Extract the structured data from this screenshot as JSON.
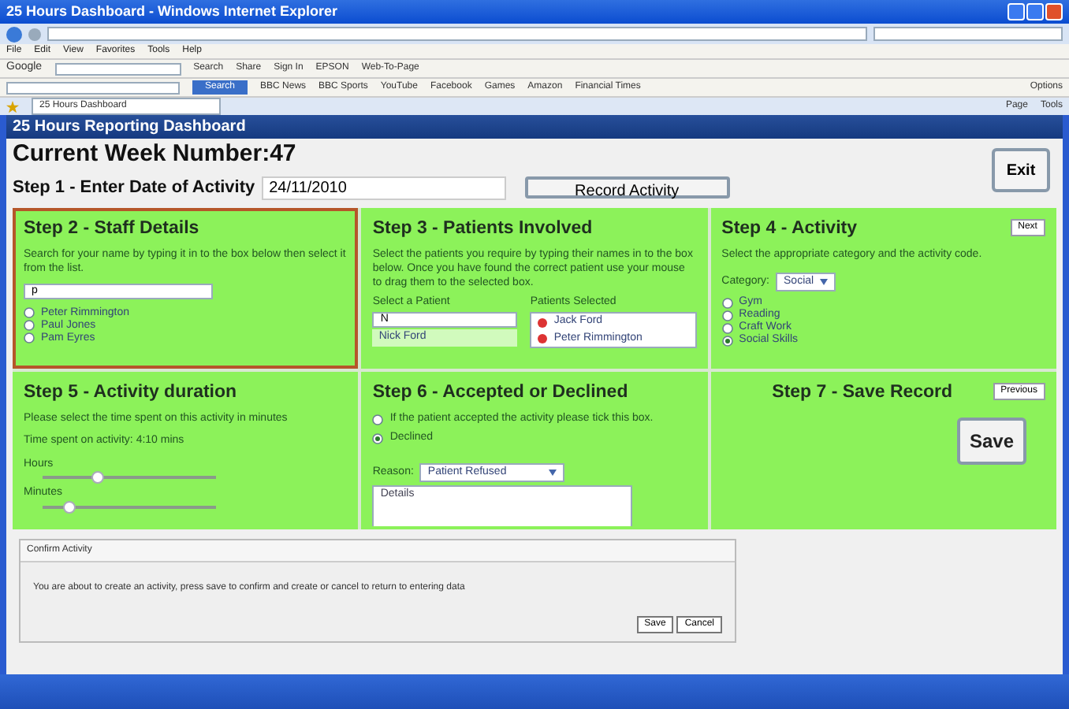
{
  "window": {
    "title": "25 Hours Dashboard - Windows Internet Explorer"
  },
  "browser": {
    "menu": [
      "File",
      "Edit",
      "View",
      "Favorites",
      "Tools",
      "Help"
    ],
    "google_toolbar": {
      "label": "Google",
      "items": [
        "Search",
        "Share",
        "Sign In",
        "EPSON",
        "Web-To-Page"
      ]
    },
    "links_toolbar": {
      "button": "Search",
      "items": [
        "BBC News",
        "BBC Sports",
        "YouTube",
        "Facebook",
        "Games",
        "Amazon",
        "Financial Times"
      ],
      "options": "Options"
    },
    "tab": "25 Hours Dashboard",
    "commands": [
      "Page",
      "Tools"
    ]
  },
  "app": {
    "title": "25 Hours Reporting Dashboard",
    "week": "Current Week Number:47",
    "step1": {
      "label": "Step 1 - Enter Date of Activity",
      "date": "24/11/2010",
      "button": "Record Activity"
    },
    "exit": "Exit",
    "steps": [
      {
        "kind": "staff",
        "title": "Step 2 - Staff Details",
        "active": true,
        "text": "Search for your name by typing it in to the box below then select it from the list.",
        "search": "p",
        "options": [
          {
            "label": "Peter Rimmington",
            "selected": false
          },
          {
            "label": "Paul Jones",
            "selected": false
          },
          {
            "label": "Pam Eyres",
            "selected": false
          }
        ]
      },
      {
        "kind": "patients",
        "title": "Step 3 - Patients Involved",
        "active": false,
        "text": "Select the patients you require by typing their names in to the box below. Once you have found the correct patient use your mouse to drag them to the selected box.",
        "select_label": "Select a Patient",
        "search": "N",
        "results": [
          "Nick Ford"
        ],
        "selected_label": "Patients Selected",
        "selected_patients": [
          "Jack Ford",
          "Peter Rimmington"
        ]
      },
      {
        "kind": "activity",
        "title": "Step 4 - Activity",
        "active": false,
        "nav": "Next",
        "text": "Select the appropriate category and the activity code.",
        "category_label": "Category:",
        "category": "Social",
        "options": [
          {
            "label": "Gym",
            "selected": false
          },
          {
            "label": "Reading",
            "selected": false
          },
          {
            "label": "Craft Work",
            "selected": false
          },
          {
            "label": "Social Skills",
            "selected": true
          }
        ]
      },
      {
        "kind": "duration",
        "title": "Step 5 - Activity duration",
        "active": false,
        "text": "Please select the time spent on this activity in minutes",
        "time": "Time spent on activity: 4:10 mins",
        "sliders": [
          {
            "label": "Hours",
            "level": 0.32
          },
          {
            "label": "Minutes",
            "level": 0.15
          }
        ]
      },
      {
        "kind": "accepted",
        "title": "Step 6 - Accepted or Declined",
        "active": false,
        "options": [
          {
            "label": "If the patient accepted the activity please tick this box.",
            "selected": false
          },
          {
            "label": "Declined",
            "selected": true
          }
        ],
        "reason_label": "Reason:",
        "reason": "Patient Refused",
        "details": "Details"
      },
      {
        "kind": "save",
        "title": "Step 7 - Save Record",
        "active": false,
        "nav": "Previous",
        "button": "Save"
      }
    ],
    "dialog": {
      "title": "Confirm Activity",
      "text": "You are about to create an activity, press save to confirm and create or cancel to return to entering data",
      "buttons": [
        "Save",
        "Cancel"
      ]
    }
  }
}
